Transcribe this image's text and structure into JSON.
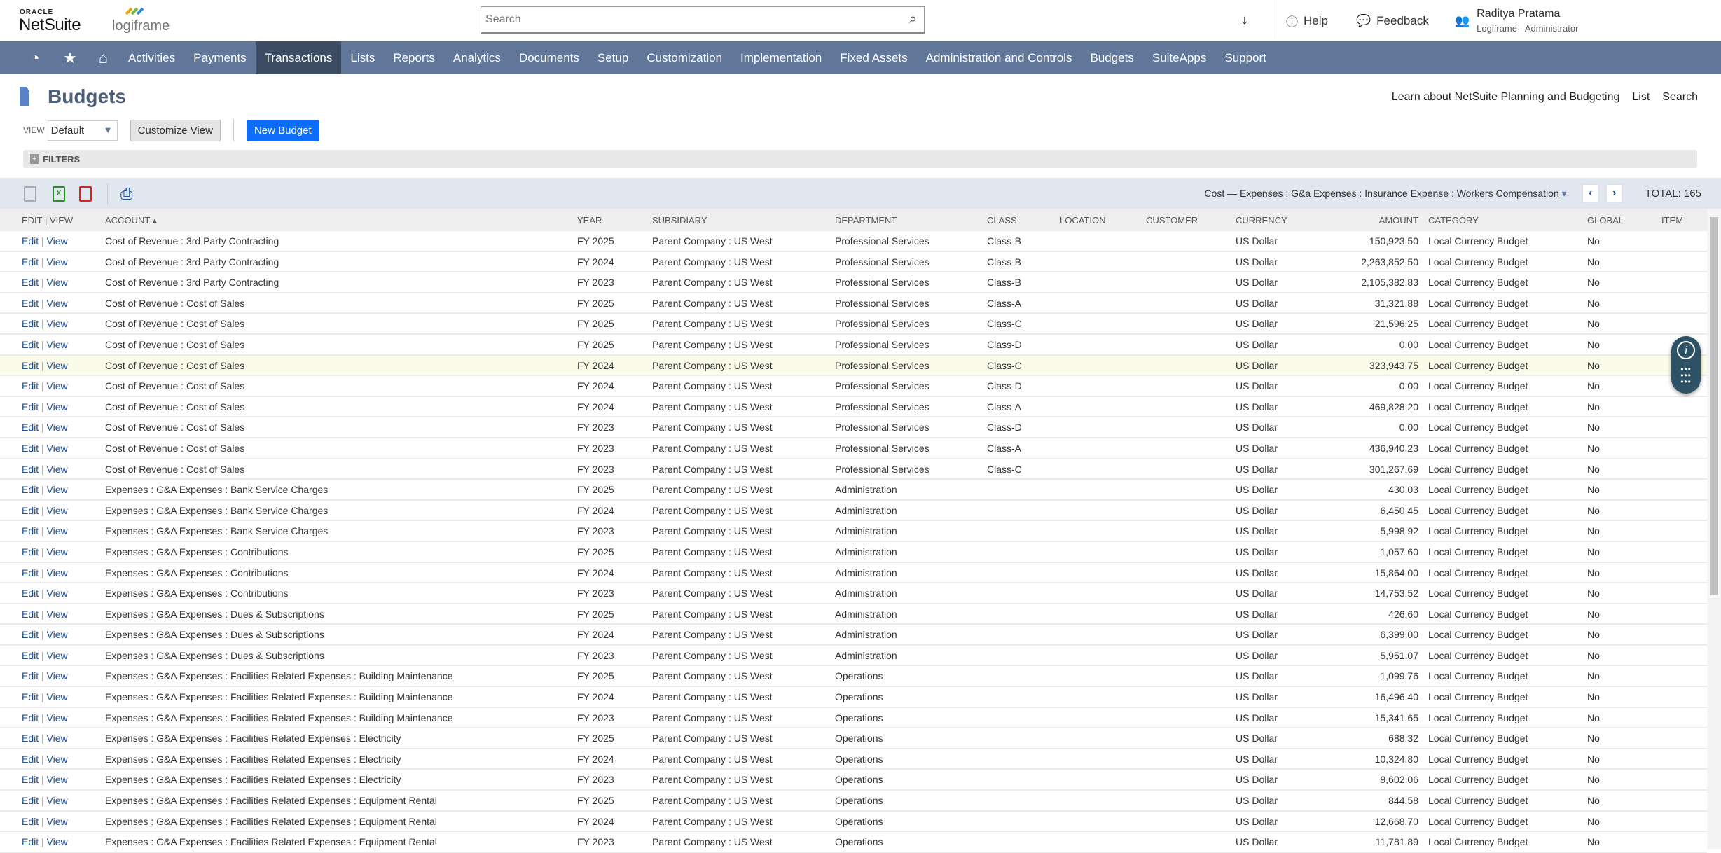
{
  "header": {
    "oracle": "ORACLE",
    "netsuite": "NetSuite",
    "company_logo": "logiframe",
    "search_placeholder": "Search",
    "help": "Help",
    "feedback": "Feedback",
    "user_name": "Raditya Pratama",
    "user_role": "Logiframe - Administrator"
  },
  "nav": {
    "items": [
      "Activities",
      "Payments",
      "Transactions",
      "Lists",
      "Reports",
      "Analytics",
      "Documents",
      "Setup",
      "Customization",
      "Implementation",
      "Fixed Assets",
      "Administration and Controls",
      "Budgets",
      "SuiteApps",
      "Support"
    ],
    "active": "Transactions"
  },
  "page": {
    "title": "Budgets",
    "links": [
      "Learn about NetSuite Planning and Budgeting",
      "List",
      "Search"
    ],
    "view_label": "VIEW",
    "view_value": "Default",
    "customize_view": "Customize View",
    "new_budget": "New Budget",
    "filters": "FILTERS"
  },
  "pager": {
    "range": "Cost — Expenses : G&a Expenses : Insurance Expense : Workers Compensation",
    "total": "TOTAL: 165"
  },
  "columns": {
    "edit_view": "EDIT | VIEW",
    "account": "ACCOUNT ▴",
    "year": "YEAR",
    "subsidiary": "SUBSIDIARY",
    "department": "DEPARTMENT",
    "class": "CLASS",
    "location": "LOCATION",
    "customer": "CUSTOMER",
    "currency": "CURRENCY",
    "amount": "AMOUNT",
    "category": "CATEGORY",
    "global": "GLOBAL",
    "item": "ITEM"
  },
  "row_defaults": {
    "edit": "Edit",
    "view": "View",
    "sep": "|",
    "subsidiary": "Parent Company : US West",
    "currency": "US Dollar",
    "category": "Local Currency Budget",
    "global": "No"
  },
  "rows": [
    [
      "Cost of Revenue : 3rd Party Contracting",
      "FY 2025",
      "Professional Services",
      "Class-B",
      "150,923.50"
    ],
    [
      "Cost of Revenue : 3rd Party Contracting",
      "FY 2024",
      "Professional Services",
      "Class-B",
      "2,263,852.50"
    ],
    [
      "Cost of Revenue : 3rd Party Contracting",
      "FY 2023",
      "Professional Services",
      "Class-B",
      "2,105,382.83"
    ],
    [
      "Cost of Revenue : Cost of Sales",
      "FY 2025",
      "Professional Services",
      "Class-A",
      "31,321.88"
    ],
    [
      "Cost of Revenue : Cost of Sales",
      "FY 2025",
      "Professional Services",
      "Class-C",
      "21,596.25"
    ],
    [
      "Cost of Revenue : Cost of Sales",
      "FY 2025",
      "Professional Services",
      "Class-D",
      "0.00"
    ],
    [
      "Cost of Revenue : Cost of Sales",
      "FY 2024",
      "Professional Services",
      "Class-C",
      "323,943.75"
    ],
    [
      "Cost of Revenue : Cost of Sales",
      "FY 2024",
      "Professional Services",
      "Class-D",
      "0.00"
    ],
    [
      "Cost of Revenue : Cost of Sales",
      "FY 2024",
      "Professional Services",
      "Class-A",
      "469,828.20"
    ],
    [
      "Cost of Revenue : Cost of Sales",
      "FY 2023",
      "Professional Services",
      "Class-D",
      "0.00"
    ],
    [
      "Cost of Revenue : Cost of Sales",
      "FY 2023",
      "Professional Services",
      "Class-A",
      "436,940.23"
    ],
    [
      "Cost of Revenue : Cost of Sales",
      "FY 2023",
      "Professional Services",
      "Class-C",
      "301,267.69"
    ],
    [
      "Expenses : G&A Expenses : Bank Service Charges",
      "FY 2025",
      "Administration",
      "",
      "430.03"
    ],
    [
      "Expenses : G&A Expenses : Bank Service Charges",
      "FY 2024",
      "Administration",
      "",
      "6,450.45"
    ],
    [
      "Expenses : G&A Expenses : Bank Service Charges",
      "FY 2023",
      "Administration",
      "",
      "5,998.92"
    ],
    [
      "Expenses : G&A Expenses : Contributions",
      "FY 2025",
      "Administration",
      "",
      "1,057.60"
    ],
    [
      "Expenses : G&A Expenses : Contributions",
      "FY 2024",
      "Administration",
      "",
      "15,864.00"
    ],
    [
      "Expenses : G&A Expenses : Contributions",
      "FY 2023",
      "Administration",
      "",
      "14,753.52"
    ],
    [
      "Expenses : G&A Expenses : Dues & Subscriptions",
      "FY 2025",
      "Administration",
      "",
      "426.60"
    ],
    [
      "Expenses : G&A Expenses : Dues & Subscriptions",
      "FY 2024",
      "Administration",
      "",
      "6,399.00"
    ],
    [
      "Expenses : G&A Expenses : Dues & Subscriptions",
      "FY 2023",
      "Administration",
      "",
      "5,951.07"
    ],
    [
      "Expenses : G&A Expenses : Facilities Related Expenses : Building Maintenance",
      "FY 2025",
      "Operations",
      "",
      "1,099.76"
    ],
    [
      "Expenses : G&A Expenses : Facilities Related Expenses : Building Maintenance",
      "FY 2024",
      "Operations",
      "",
      "16,496.40"
    ],
    [
      "Expenses : G&A Expenses : Facilities Related Expenses : Building Maintenance",
      "FY 2023",
      "Operations",
      "",
      "15,341.65"
    ],
    [
      "Expenses : G&A Expenses : Facilities Related Expenses : Electricity",
      "FY 2025",
      "Operations",
      "",
      "688.32"
    ],
    [
      "Expenses : G&A Expenses : Facilities Related Expenses : Electricity",
      "FY 2024",
      "Operations",
      "",
      "10,324.80"
    ],
    [
      "Expenses : G&A Expenses : Facilities Related Expenses : Electricity",
      "FY 2023",
      "Operations",
      "",
      "9,602.06"
    ],
    [
      "Expenses : G&A Expenses : Facilities Related Expenses : Equipment Rental",
      "FY 2025",
      "Operations",
      "",
      "844.58"
    ],
    [
      "Expenses : G&A Expenses : Facilities Related Expenses : Equipment Rental",
      "FY 2024",
      "Operations",
      "",
      "12,668.70"
    ],
    [
      "Expenses : G&A Expenses : Facilities Related Expenses : Equipment Rental",
      "FY 2023",
      "Operations",
      "",
      "11,781.89"
    ]
  ],
  "highlighted_row": 6,
  "colors": {
    "nav": "#607799",
    "nav_active": "#3c4c63",
    "primary_button": "#0d6efd",
    "link": "#23508f",
    "row_highlight": "#fbfbe9"
  }
}
